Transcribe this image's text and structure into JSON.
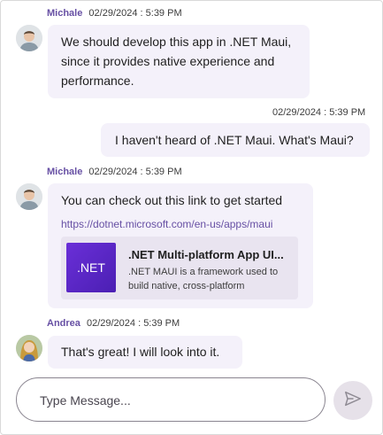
{
  "messages": [
    {
      "author": "Michale",
      "timestamp": "02/29/2024 : 5:39 PM",
      "lines": [
        "We should develop this app in .NET Maui,",
        "since it provides native experience and",
        "performance."
      ]
    },
    {
      "author": "",
      "timestamp": "02/29/2024 : 5:39 PM",
      "text": "I haven't heard of .NET Maui. What's Maui?"
    },
    {
      "author": "Michale",
      "timestamp": "02/29/2024 : 5:39 PM",
      "text": "You can check out this link to get started",
      "link": "https://dotnet.microsoft.com/en-us/apps/maui",
      "preview": {
        "logo_text": ".NET",
        "title": ".NET Multi-platform App UI...",
        "description": ".NET MAUI is a framework used to build native, cross-platform"
      }
    },
    {
      "author": "Andrea",
      "timestamp": "02/29/2024 : 5:39 PM",
      "text": "That's great! I will look into it."
    }
  ],
  "composer": {
    "placeholder": "Type Message...",
    "send_icon": "send-icon"
  },
  "colors": {
    "accent": "#6750a4",
    "bubble": "#f4f1fa",
    "preview_bg": "#e9e4f0",
    "send_button": "#e6e1e9"
  }
}
